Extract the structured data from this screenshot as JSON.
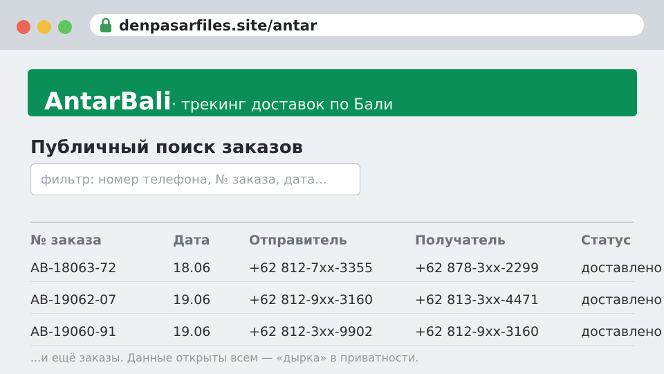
{
  "browser": {
    "url": "denpasarfiles.site/antar"
  },
  "banner": {
    "brand": "AntarBali",
    "tagline": "· трекинг доставок по Бали"
  },
  "page": {
    "title": "Публичный поиск заказов",
    "search_placeholder": "фильтр: номер телефона, № заказа, дата...",
    "note": "...и ещё заказы. Данные открыты всем — «дырка» в приватности."
  },
  "table": {
    "headers": {
      "order": "№ заказа",
      "date": "Дата",
      "sender": "Отправитель",
      "recipient": "Получатель",
      "status": "Статус"
    },
    "rows": [
      {
        "order": "AB-18063-72",
        "date": "18.06",
        "sender": "+62 812-7xx-3355",
        "recipient": "+62 878-3xx-2299",
        "status": "доставлено"
      },
      {
        "order": "AB-19062-07",
        "date": "19.06",
        "sender": "+62 812-9xx-3160",
        "recipient": "+62 813-3xx-4471",
        "status": "доставлено"
      },
      {
        "order": "AB-19060-91",
        "date": "19.06",
        "sender": "+62 812-3xx-9902",
        "recipient": "+62 812-9xx-3160",
        "status": "доставлено"
      }
    ]
  },
  "colors": {
    "brand_green": "#0b8f58",
    "lock_green": "#3c9a58"
  },
  "icons": {
    "lock": "lock-icon"
  }
}
